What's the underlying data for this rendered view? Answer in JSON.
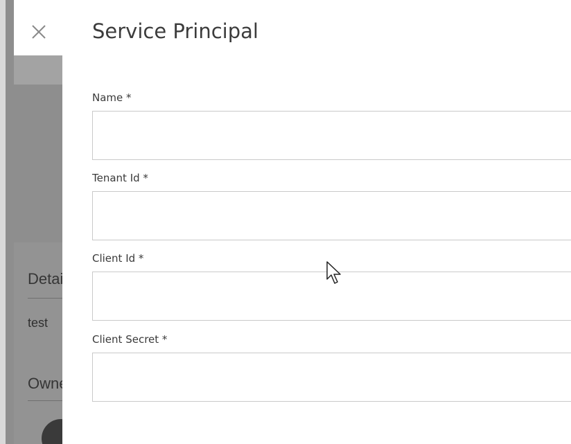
{
  "background": {
    "heading_details": "Details",
    "value_text": "test",
    "heading_owners": "Owners"
  },
  "dialog": {
    "title": "Service Principal",
    "close_icon": "close-icon",
    "fields": {
      "name": {
        "label": "Name *",
        "value": "",
        "placeholder": ""
      },
      "tenant_id": {
        "label": "Tenant Id *",
        "value": "",
        "placeholder": ""
      },
      "client_id": {
        "label": "Client Id *",
        "value": "",
        "placeholder": ""
      },
      "client_secret": {
        "label": "Client Secret *",
        "value": "",
        "placeholder": ""
      }
    }
  },
  "colors": {
    "overlay": "#8e8e8e",
    "panel": "#ffffff",
    "input_border": "#c9c9c9",
    "text": "#3a3a3a"
  }
}
